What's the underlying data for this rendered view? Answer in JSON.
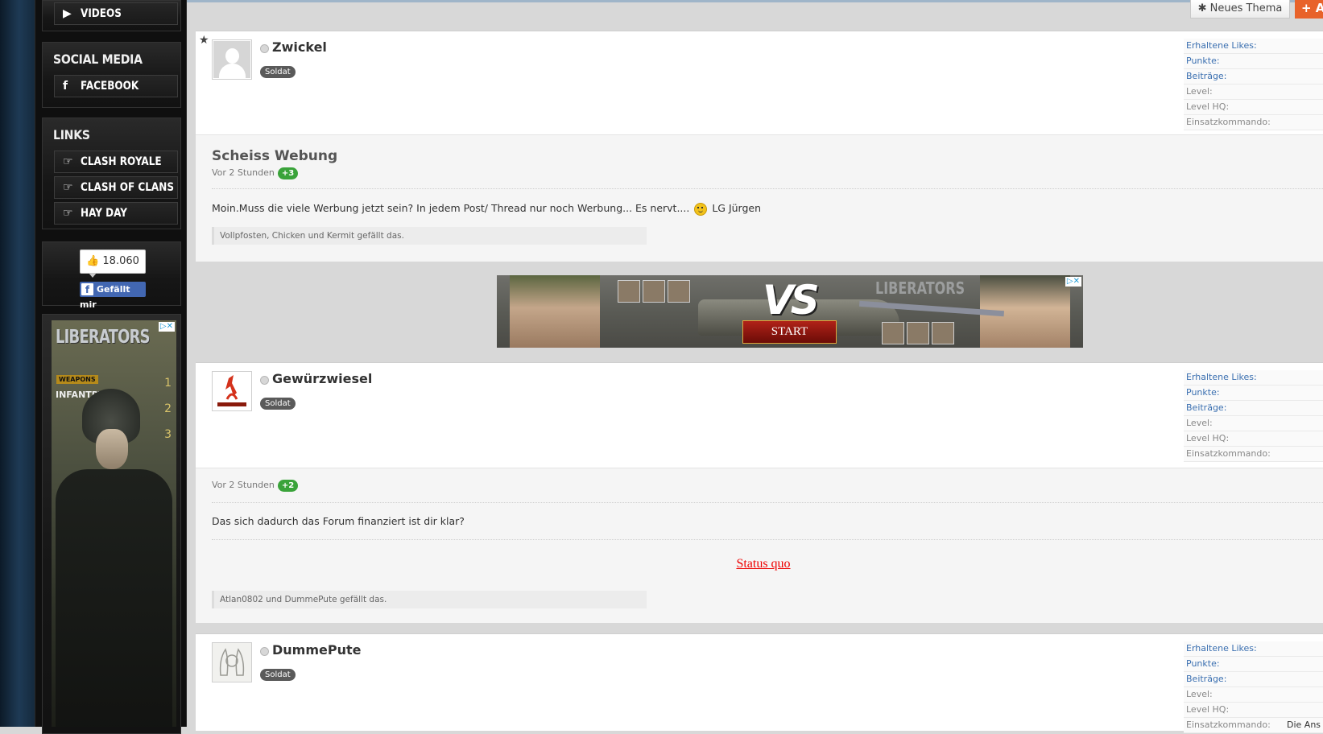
{
  "sidebar": {
    "videos_label": "VIDEOS",
    "social_title": "SOCIAL MEDIA",
    "facebook_label": "FACEBOOK",
    "links_title": "LINKS",
    "links": [
      "CLASH ROYALE",
      "CLASH OF CLANS",
      "HAY DAY"
    ],
    "fb_count": "18.060",
    "fb_like_label": "Gefällt mir"
  },
  "side_ad": {
    "logo": "LIBERATORS",
    "weapons": "WEAPONS",
    "infantry": "INFANTRY",
    "nums": [
      "1",
      "2",
      "3"
    ]
  },
  "topbar": {
    "new_thread_label": "Neues Thema",
    "orange_label": "+ A"
  },
  "stat_labels": [
    "Erhaltene Likes:",
    "Punkte:",
    "Beiträge:",
    "Level:",
    "Level HQ:",
    "Einsatzkommando:"
  ],
  "posts": [
    {
      "username": "Zwickel",
      "rank": "Soldat",
      "title": "Scheiss Webung",
      "time": "Vor 2 Stunden",
      "badge": "+3",
      "content_before": "Moin.Muss die viele Werbung jetzt sein? In jedem Post/ Thread nur noch Werbung... Es nervt....",
      "content_after": "LG Jürgen",
      "likes": "Vollpfosten, Chicken und Kermit gefällt das."
    },
    {
      "username": "Gewürzwiesel",
      "rank": "Soldat",
      "time": "Vor 2 Stunden",
      "badge": "+2",
      "content": "Das sich dadurch das Forum finanziert ist dir klar?",
      "status_link": "Status quo",
      "likes": "Atlan0802 und DummePute gefällt das."
    },
    {
      "username": "DummePute",
      "rank": "Soldat",
      "last_stat_value": "Die Ans"
    }
  ],
  "banner": {
    "vs": "VS",
    "start": "START",
    "logo": "LIBERATORS"
  },
  "colors": {
    "accent_orange": "#e8622a",
    "like_badge": "#3aa33a",
    "stat_blue": "#3a6fb0",
    "status_link": "#e00000"
  }
}
